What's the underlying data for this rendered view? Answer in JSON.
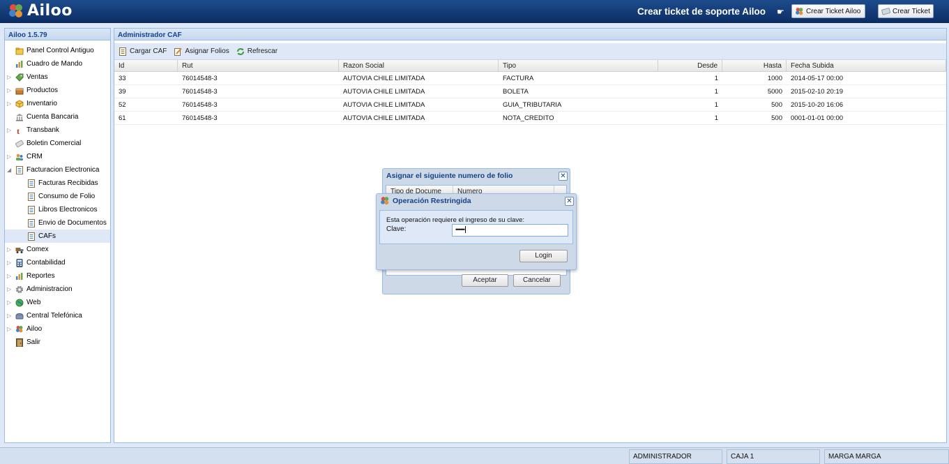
{
  "app": {
    "logo_text": "Ailoo"
  },
  "header": {
    "support_text": "Crear ticket de soporte Ailoo",
    "hand_icon": "pointing-hand-icon",
    "btn_ailoo": "Crear Ticket Ailoo",
    "btn_ticket": "Crear Ticket"
  },
  "sidebar": {
    "title": "Ailoo 1.5.79",
    "items": [
      {
        "label": "Panel Control Antiguo",
        "icon": "folder-icon",
        "level": 0,
        "expandable": false
      },
      {
        "label": "Cuadro de Mando",
        "icon": "bar-chart-icon",
        "level": 0,
        "expandable": false
      },
      {
        "label": "Ventas",
        "icon": "tag-icon",
        "level": 0,
        "expandable": true
      },
      {
        "label": "Productos",
        "icon": "box-icon",
        "level": 0,
        "expandable": true
      },
      {
        "label": "Inventario",
        "icon": "cube-icon",
        "level": 0,
        "expandable": true
      },
      {
        "label": "Cuenta Bancaria",
        "icon": "bank-icon",
        "level": 0,
        "expandable": false
      },
      {
        "label": "Transbank",
        "icon": "transbank-icon",
        "level": 0,
        "expandable": true
      },
      {
        "label": "Boletin Comercial",
        "icon": "ticket-icon",
        "level": 0,
        "expandable": false
      },
      {
        "label": "CRM",
        "icon": "users-icon",
        "level": 0,
        "expandable": true
      },
      {
        "label": "Facturacion Electronica",
        "icon": "document-icon",
        "level": 0,
        "expandable": true,
        "expanded": true
      },
      {
        "label": "Facturas Recibidas",
        "icon": "document-icon",
        "level": 1
      },
      {
        "label": "Consumo de Folio",
        "icon": "document-icon",
        "level": 1
      },
      {
        "label": "Libros Electronicos",
        "icon": "document-icon",
        "level": 1
      },
      {
        "label": "Envio de Documentos",
        "icon": "document-icon",
        "level": 1
      },
      {
        "label": "CAFs",
        "icon": "document-icon",
        "level": 1,
        "selected": true
      },
      {
        "label": "Comex",
        "icon": "truck-icon",
        "level": 0,
        "expandable": true
      },
      {
        "label": "Contabilidad",
        "icon": "calculator-icon",
        "level": 0,
        "expandable": true
      },
      {
        "label": "Reportes",
        "icon": "bar-chart-icon",
        "level": 0,
        "expandable": true
      },
      {
        "label": "Administracion",
        "icon": "gear-icon",
        "level": 0,
        "expandable": true
      },
      {
        "label": "Web",
        "icon": "globe-icon",
        "level": 0,
        "expandable": true
      },
      {
        "label": "Central Telefónica",
        "icon": "phone-icon",
        "level": 0,
        "expandable": true
      },
      {
        "label": "Ailoo",
        "icon": "ailoo-logo-icon",
        "level": 0,
        "expandable": true
      },
      {
        "label": "Salir",
        "icon": "door-icon",
        "level": 0,
        "expandable": false
      }
    ]
  },
  "main": {
    "title": "Administrador CAF",
    "toolbar": {
      "cargar": "Cargar CAF",
      "asignar": "Asignar Folios",
      "refrescar": "Refrescar"
    },
    "columns": [
      "Id",
      "Rut",
      "Razon Social",
      "Tipo",
      "Desde",
      "Hasta",
      "Fecha Subida"
    ],
    "rows": [
      [
        "33",
        "76014548-3",
        "AUTOVIA CHILE LIMITADA",
        "FACTURA",
        "1",
        "1000",
        "2014-05-17 00:00"
      ],
      [
        "39",
        "76014548-3",
        "AUTOVIA CHILE LIMITADA",
        "BOLETA",
        "1",
        "5000",
        "2015-02-10 20:19"
      ],
      [
        "52",
        "76014548-3",
        "AUTOVIA CHILE LIMITADA",
        "GUIA_TRIBUTARIA",
        "1",
        "500",
        "2015-10-20 16:06"
      ],
      [
        "61",
        "76014548-3",
        "AUTOVIA CHILE LIMITADA",
        "NOTA_CREDITO",
        "1",
        "500",
        "0001-01-01 00:00"
      ]
    ]
  },
  "folio_dialog": {
    "title": "Asignar el siguiente numero de folio",
    "col1": "Tipo de Docume",
    "col2": "Numero",
    "accept": "Aceptar",
    "cancel": "Cancelar"
  },
  "login_dialog": {
    "title": "Operación Restringida",
    "message": "Esta operación requiere el ingreso de su clave:",
    "label": "Clave:",
    "password_mask": "••••••",
    "login": "Login"
  },
  "status": {
    "user": "ADMINISTRADOR",
    "register": "CAJA 1",
    "store": "MARGA MARGA"
  }
}
